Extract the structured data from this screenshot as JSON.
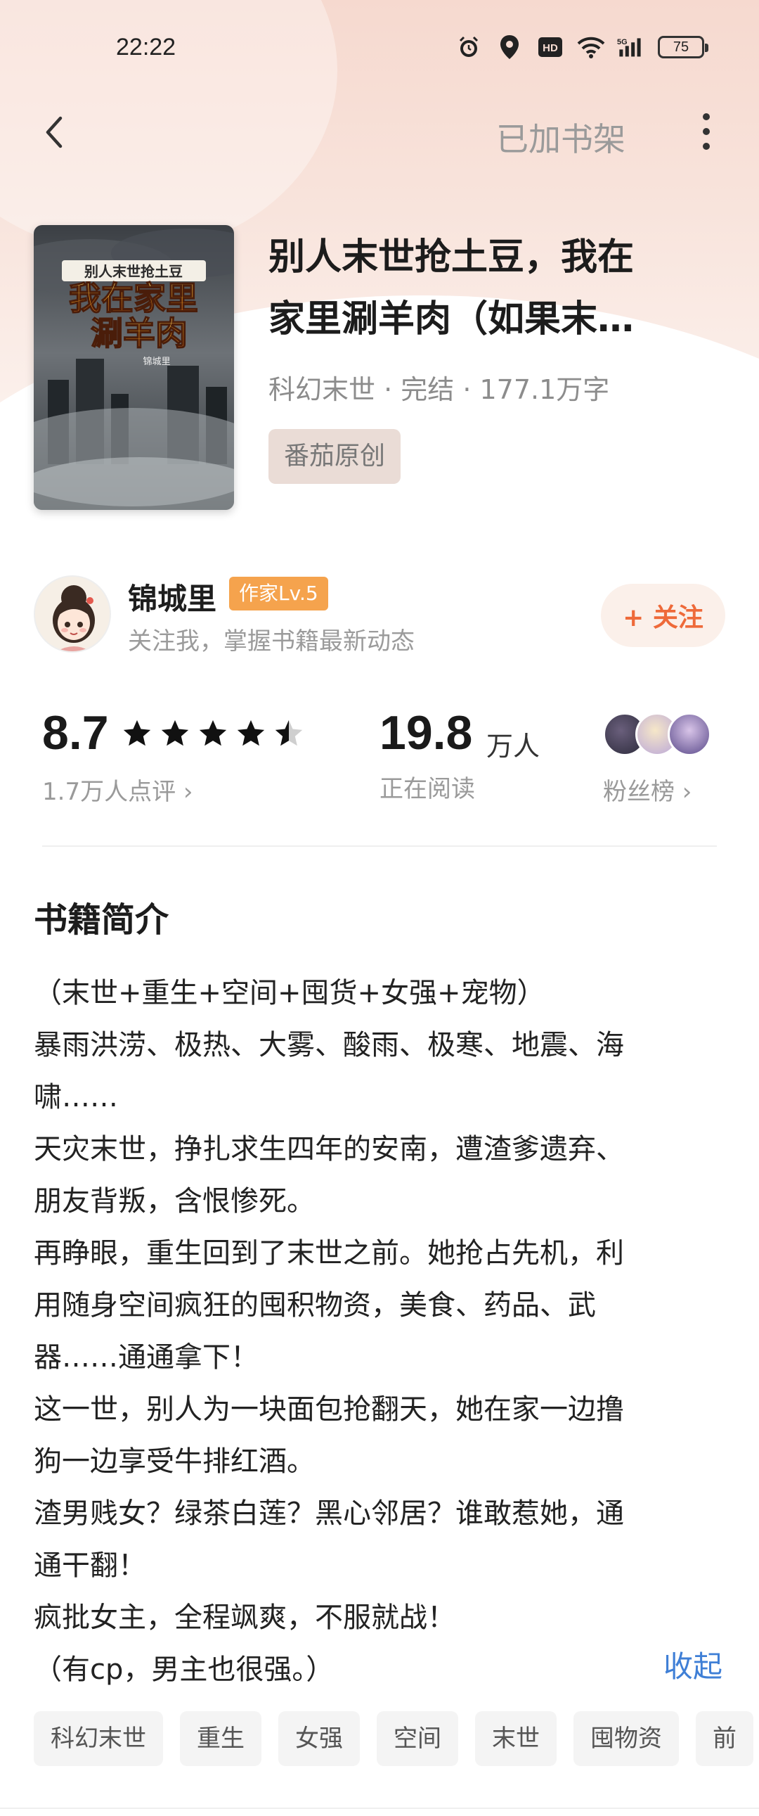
{
  "status_bar": {
    "time": "22:22",
    "icons": [
      "alarm-icon",
      "location-icon",
      "hd-icon",
      "wifi-icon",
      "5g-signal-icon"
    ],
    "battery": "75"
  },
  "nav": {
    "back_icon": "chevron-left-icon",
    "shelf_label": "已加书架",
    "more_icon": "more-vertical-icon"
  },
  "book": {
    "cover": {
      "top_title": "别人末世抢土豆",
      "main_title_line1": "我在家里",
      "main_title_line2": "涮羊肉",
      "author": "锦城里"
    },
    "title_line1": "别人末世抢土豆，我在",
    "title_line2": "家里涮羊肉（如果末…",
    "meta": "科幻末世 · 完结 · 177.1万字",
    "publisher_tag": "番茄原创"
  },
  "author": {
    "name": "锦城里",
    "level_badge": "作家Lv.5",
    "subtitle": "关注我，掌握书籍最新动态",
    "follow_label": "+ 关注"
  },
  "stats": {
    "rating": "8.7",
    "stars": 4.5,
    "rating_count": "1.7万人点评 ›",
    "readers": "19.8",
    "readers_unit": "万人",
    "readers_label": "正在阅读",
    "fans_label": "粉丝榜 ›"
  },
  "intro": {
    "heading": "书籍简介",
    "lines": [
      "（末世+重生+空间+囤货+女强+宠物）",
      "暴雨洪涝、极热、大雾、酸雨、极寒、地震、海",
      "啸……",
      "天灾末世，挣扎求生四年的安南，遭渣爹遗弃、",
      "朋友背叛，含恨惨死。",
      "再睁眼，重生回到了末世之前。她抢占先机，利",
      "用随身空间疯狂的囤积物资，美食、药品、武",
      "器……通通拿下！",
      "这一世，别人为一块面包抢翻天，她在家一边撸",
      "狗一边享受牛排红酒。",
      "渣男贱女？绿茶白莲？黑心邻居？谁敢惹她，通",
      "通干翻！",
      "疯批女主，全程飒爽，不服就战！",
      "（有cp，男主也很强。）"
    ],
    "collapse_label": "收起"
  },
  "tags": [
    "科幻末世",
    "重生",
    "女强",
    "空间",
    "末世",
    "囤物资",
    "前"
  ],
  "colors": {
    "accent_orange": "#ee6a3a",
    "badge_orange": "#f5a34d",
    "link_blue": "#3f7fd6"
  }
}
